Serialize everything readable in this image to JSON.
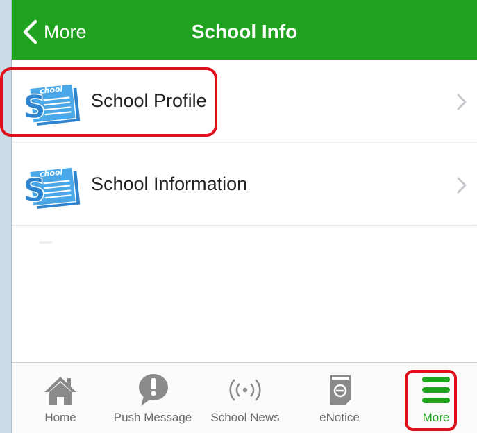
{
  "navbar": {
    "back_label": "More",
    "title": "School Info",
    "background_color": "#1fa31f"
  },
  "list": {
    "items": [
      {
        "label": "School Profile",
        "icon": "school-document-icon",
        "highlighted": true
      },
      {
        "label": "School Information",
        "icon": "school-document-icon",
        "highlighted": false
      }
    ]
  },
  "tabbar": {
    "tabs": [
      {
        "label": "Home",
        "icon": "home-icon",
        "active": false
      },
      {
        "label": "Push Message",
        "icon": "push-message-icon",
        "active": false
      },
      {
        "label": "School News",
        "icon": "broadcast-icon",
        "active": false
      },
      {
        "label": "eNotice",
        "icon": "enotice-icon",
        "active": false
      },
      {
        "label": "More",
        "icon": "menu-icon",
        "active": true
      }
    ],
    "active_color": "#1fa31f",
    "inactive_color": "#6b6b6b"
  },
  "highlight_color": "#e0101a",
  "icon_text": "chool"
}
